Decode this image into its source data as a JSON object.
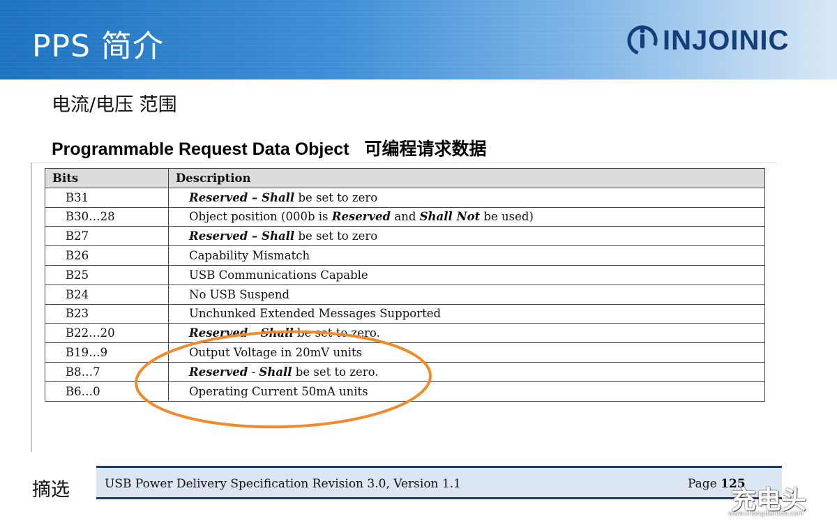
{
  "header": {
    "title": "PPS 简介",
    "logo_text": "INJOINIC"
  },
  "subtitle": "电流/电压 范围",
  "section": {
    "title_en": "Programmable Request Data Object",
    "title_cn": "可编程请求数据"
  },
  "table": {
    "headers": [
      "Bits",
      "Description"
    ],
    "rows": [
      {
        "bits": "B31",
        "parts": [
          {
            "t": "Reserved – Shall",
            "i": true
          },
          {
            "t": " be set to zero",
            "i": false
          }
        ]
      },
      {
        "bits": "B30…28",
        "parts": [
          {
            "t": "Object position (000b is ",
            "i": false
          },
          {
            "t": "Reserved",
            "i": true
          },
          {
            "t": " and ",
            "i": false
          },
          {
            "t": "Shall Not",
            "i": true
          },
          {
            "t": " be used)",
            "i": false
          }
        ]
      },
      {
        "bits": "B27",
        "parts": [
          {
            "t": "Reserved – Shall",
            "i": true
          },
          {
            "t": " be set to zero",
            "i": false
          }
        ]
      },
      {
        "bits": "B26",
        "parts": [
          {
            "t": "Capability Mismatch",
            "i": false
          }
        ]
      },
      {
        "bits": "B25",
        "parts": [
          {
            "t": "USB Communications Capable",
            "i": false
          }
        ]
      },
      {
        "bits": "B24",
        "parts": [
          {
            "t": "No USB Suspend",
            "i": false
          }
        ]
      },
      {
        "bits": "B23",
        "parts": [
          {
            "t": "Unchunked Extended Messages Supported",
            "i": false
          }
        ]
      },
      {
        "bits": "B22…20",
        "parts": [
          {
            "t": "Reserved - Shall",
            "i": true
          },
          {
            "t": " be set to zero.",
            "i": false
          }
        ]
      },
      {
        "bits": "B19…9",
        "parts": [
          {
            "t": "Output Voltage in 20mV units",
            "i": false
          }
        ]
      },
      {
        "bits": "B8…7",
        "parts": [
          {
            "t": "Reserved",
            "i": true
          },
          {
            "t": " - ",
            "i": false
          },
          {
            "t": "Shall",
            "i": true
          },
          {
            "t": " be set to zero.",
            "i": false
          }
        ]
      },
      {
        "bits": "B6…0",
        "parts": [
          {
            "t": "Operating Current 50mA units",
            "i": false
          }
        ]
      }
    ]
  },
  "footer": {
    "label": "摘选",
    "spec": "USB Power Delivery Specification Revision 3.0, Version 1.1",
    "page_prefix": "Page",
    "page_number": "125"
  },
  "watermark": {
    "brand": "充电头",
    "url": "www.chongdiantou.com"
  },
  "colors": {
    "header_blue": "#1e73be",
    "logo_navy": "#143d7a",
    "highlight_orange": "#f08a2c",
    "footer_bar": "#dce6f2"
  }
}
